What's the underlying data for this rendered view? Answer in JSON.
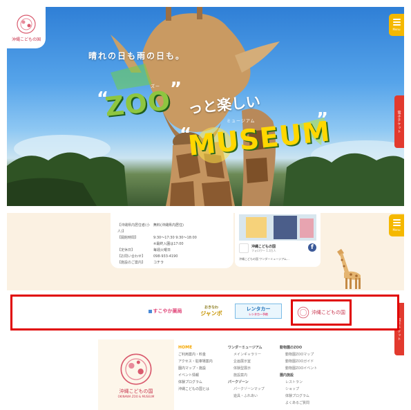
{
  "colors": {
    "accent_yellow": "#f5b800",
    "ticket_red": "#e23a2e",
    "brand_red": "#c8374f",
    "highlight": "#e00000"
  },
  "hero": {
    "tagline": "晴れの日も雨の日も。",
    "zoo": "ZOO",
    "tsuto": "っと楽しい",
    "museum": "MUSEUM",
    "ruby_zu": "ズー",
    "ruby_museum": "ミュージアム",
    "logo_label": "沖縄こどもの国",
    "menu_label": "Menu",
    "ticket_label": "電子チケット"
  },
  "info": {
    "rows": [
      {
        "k": "【沖縄県内居住者(小人)】",
        "v": "無料(沖縄県内居住)"
      },
      {
        "k": "【開館時間】",
        "v": "9:30〜17:30 9:30〜18:00"
      },
      {
        "k": "",
        "v": "※最終入園は17:00"
      },
      {
        "k": "【定休日】",
        "v": "毎週火曜日"
      },
      {
        "k": "【お問い合わせ】",
        "v": "098-933-4190"
      },
      {
        "k": "【施設のご案内】",
        "v": "コチラ"
      }
    ]
  },
  "facebook": {
    "name": "沖縄こどもの国",
    "likes": "フォロワー 1.3万人",
    "icon": "f",
    "text": "沖縄こどもの国 ワンダーミュージアム…"
  },
  "banners": {
    "b1": "すこやか薬局",
    "b2_top": "おきなわ",
    "b2_big": "ジャンボ",
    "b3_a": "レンタカー",
    "b3_b": "レンタカー予約",
    "b4": "沖縄こどもの国"
  },
  "footer": {
    "logo_label": "沖縄こどもの国",
    "logo_sub": "OKINAWA ZOO & MUSEUM",
    "col1": {
      "home": "HOME",
      "items": [
        "ご利用案内・料金",
        "アクセス・駐車場案内",
        "園内マップ・施設",
        "イベント情報",
        "体験プログラム",
        "沖縄こどもの国とは"
      ]
    },
    "col2": {
      "head1": "ワンダーミュージアム",
      "items1": [
        "メインギャラリー",
        "企画展示室",
        "体験型展示",
        "施設案内"
      ],
      "head2": "パークゾーン",
      "items2": [
        "パークゾーンマップ",
        "遊具・ふれあい"
      ]
    },
    "col3": {
      "head1": "動物園のZOO",
      "items1": [
        "動物園ZOOマップ",
        "動物園ZOOガイド",
        "動物園ZOOイベント"
      ],
      "head2": "園内施設",
      "items2": [
        "レストラン",
        "ショップ",
        "体験プログラム",
        "よくあるご質問"
      ]
    }
  }
}
